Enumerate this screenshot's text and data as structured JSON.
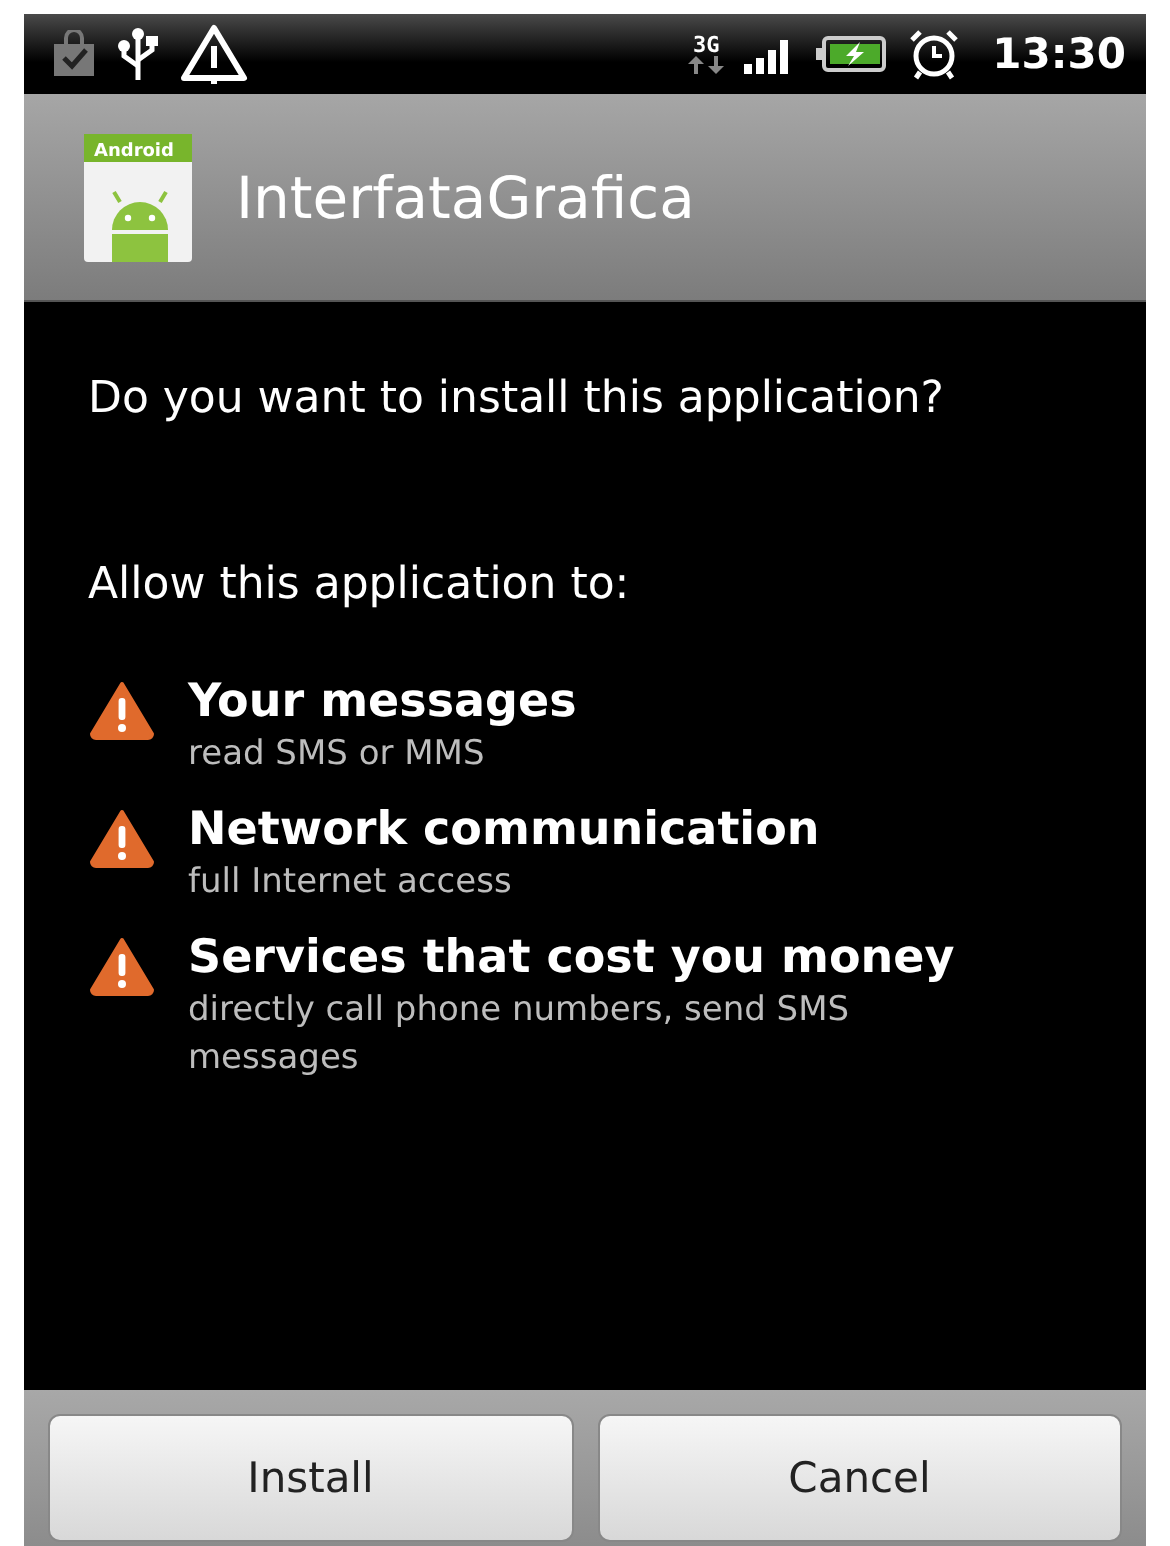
{
  "status_bar": {
    "network": "3G",
    "time": "13:30"
  },
  "app": {
    "icon_label": "Android",
    "title": "InterfataGrafica"
  },
  "question": "Do you want to install this application?",
  "permissions_heading": "Allow this application to:",
  "permissions": [
    {
      "title": "Your messages",
      "detail": "read SMS or MMS"
    },
    {
      "title": "Network communication",
      "detail": "full Internet access"
    },
    {
      "title": "Services that cost you money",
      "detail": "directly call phone numbers, send SMS messages"
    }
  ],
  "buttons": [
    "Install",
    "Cancel"
  ]
}
